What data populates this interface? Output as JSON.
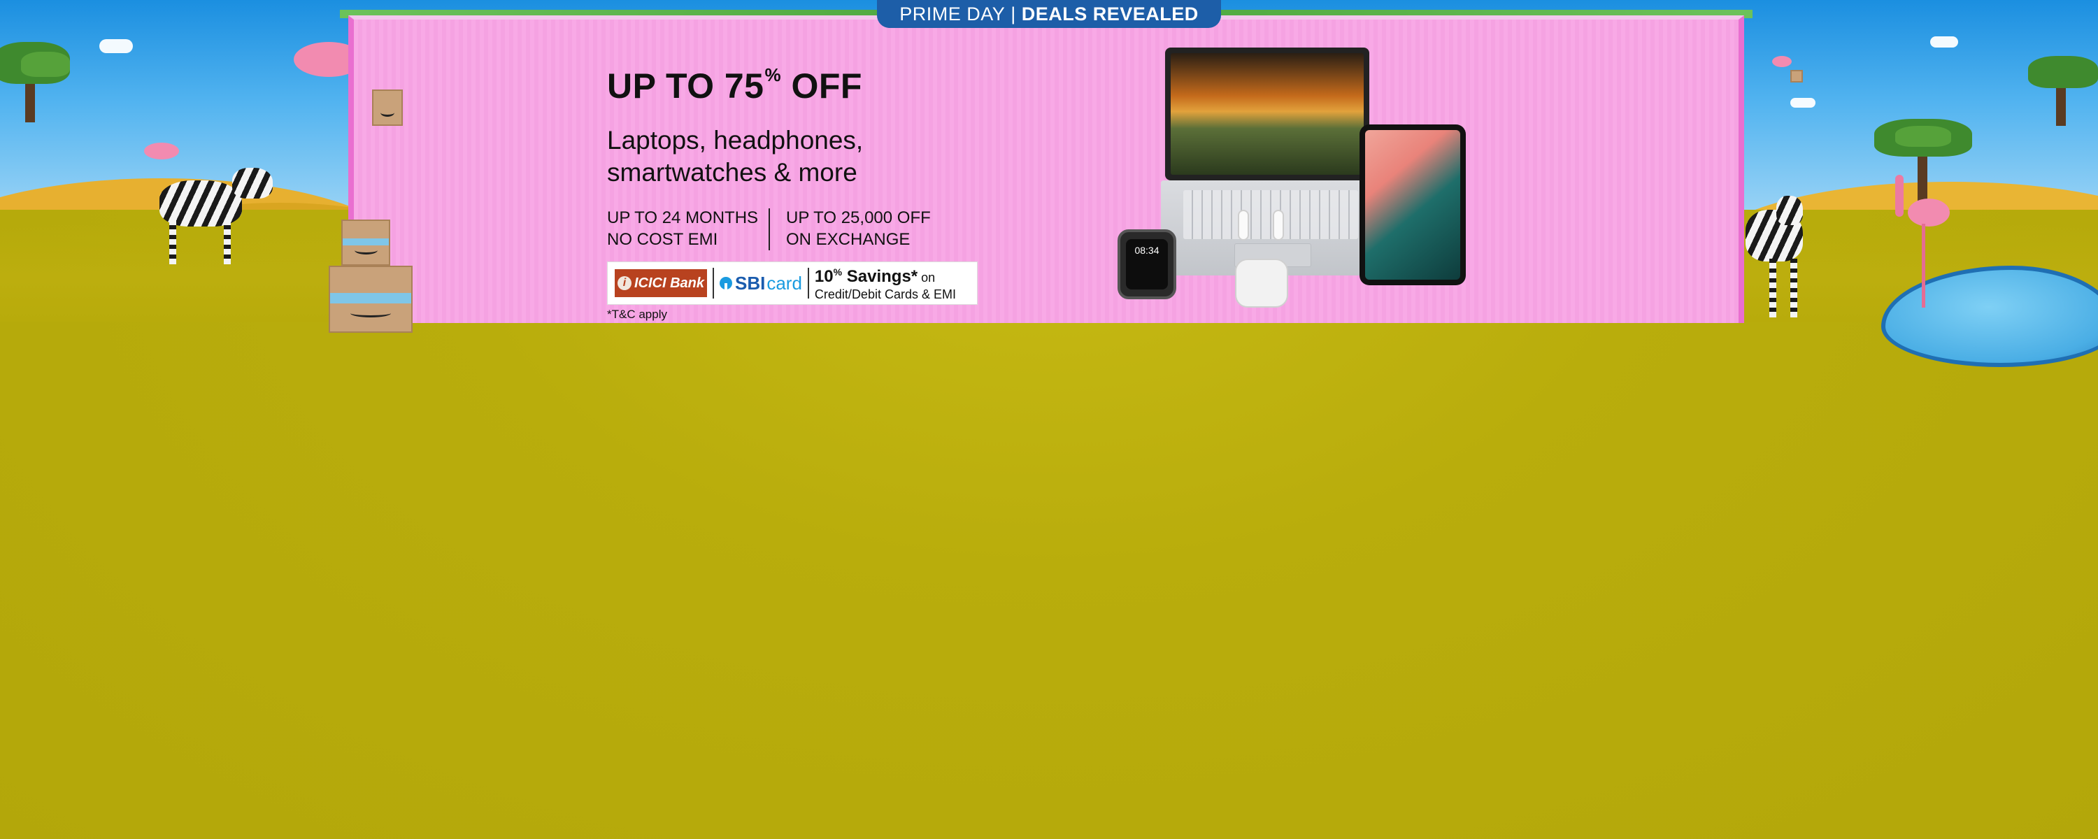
{
  "banner": {
    "tab": {
      "prefix": "PRIME DAY",
      "separator": "|",
      "emphasis": "DEALS REVEALED"
    },
    "headline": {
      "main": "UP TO 75",
      "percent": "%",
      "suffix": " OFF"
    },
    "subheadline_line1": "Laptops, headphones,",
    "subheadline_line2": "smartwatches & more",
    "emi": {
      "line1": "UP TO 24 MONTHS",
      "line2": "NO COST EMI"
    },
    "exchange": {
      "line1": "UP TO 25,000 OFF",
      "line2": "ON EXCHANGE"
    },
    "bank_offer": {
      "icici_label": "ICICI Bank",
      "icici_mark": "i",
      "sbi_label": "SBI",
      "sbi_card_label": "card",
      "savings_value": "10",
      "savings_percent": "%",
      "savings_label": " Savings*",
      "savings_on": " on",
      "savings_detail": "Credit/Debit Cards & EMI"
    },
    "terms": "*T&C apply",
    "watch_time": "08:34"
  },
  "colors": {
    "banner_pink": "#f8a9e6",
    "tab_blue": "#1d5ea8",
    "grass": "#b7ab0a",
    "sky": "#1b8fe0",
    "icici_red": "#b8421f",
    "sbi_blue": "#1a5cae"
  },
  "icons": [
    "tree-icon",
    "cloud-icon",
    "zebra-icon",
    "flamingo-icon",
    "amazon-box-icon",
    "laptop-icon",
    "tablet-icon",
    "smartwatch-icon",
    "earbuds-icon",
    "pond-icon"
  ]
}
